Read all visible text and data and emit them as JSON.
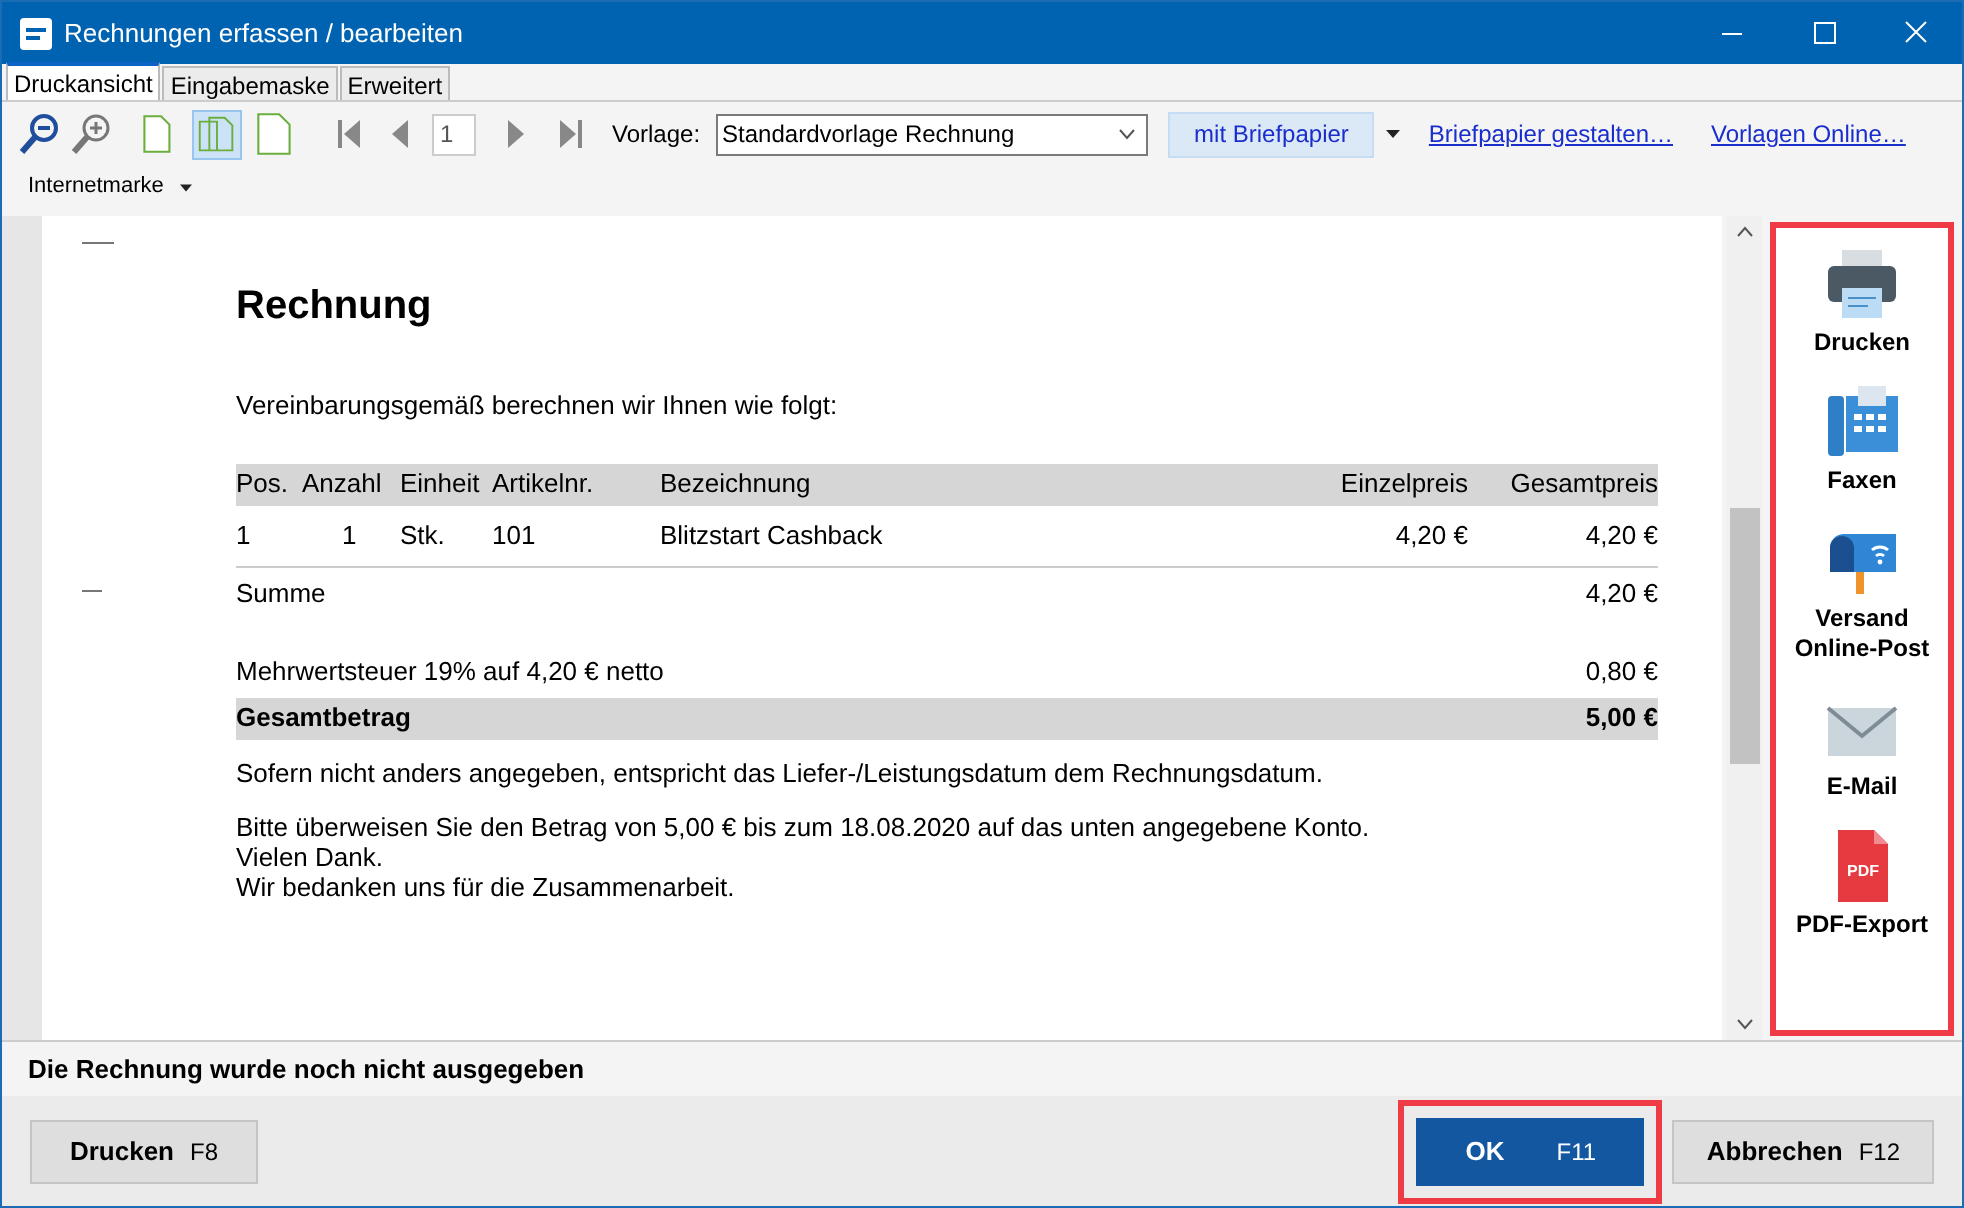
{
  "window": {
    "title": "Rechnungen erfassen / bearbeiten"
  },
  "tabs": [
    {
      "label": "Druckansicht",
      "selected": true
    },
    {
      "label": "Eingabemaske",
      "selected": false
    },
    {
      "label": "Erweitert",
      "selected": false
    }
  ],
  "toolbar": {
    "page_views": [
      {
        "kind": "single",
        "selected": false
      },
      {
        "kind": "double",
        "selected": true
      },
      {
        "kind": "wide",
        "selected": false
      }
    ],
    "page_number": "1",
    "template_label": "Vorlage:",
    "template_value": "Standardvorlage Rechnung",
    "letterhead_button": "mit Briefpapier",
    "links": [
      "Briefpapier gestalten…",
      "Vorlagen Online…"
    ],
    "stamp_menu": "Internetmarke"
  },
  "document": {
    "heading": "Rechnung",
    "intro": "Vereinbarungsgemäß berechnen wir Ihnen wie folgt:",
    "columns": [
      "Pos.",
      "Anzahl",
      "Einheit",
      "Artikelnr.",
      "Bezeichnung",
      "Einzelpreis",
      "Gesamtpreis"
    ],
    "rows": [
      [
        "1",
        "1",
        "Stk.",
        "101",
        "Blitzstart Cashback",
        "4,20 €",
        "4,20 €"
      ]
    ],
    "sum": {
      "label": "Summe",
      "value": "4,20 €"
    },
    "tax": {
      "label": "Mehrwertsteuer 19% auf 4,20 € netto",
      "value": "0,80 €"
    },
    "total": {
      "label": "Gesamtbetrag",
      "value": "5,00 €"
    },
    "notes": [
      "Sofern nicht anders angegeben, entspricht das Liefer-/Leistungsdatum dem Rechnungsdatum."
    ],
    "closing": [
      "Bitte überweisen Sie den Betrag von 5,00 € bis zum 18.08.2020 auf das unten angegebene Konto.",
      "Vielen Dank.",
      "Wir bedanken uns für die Zusammenarbeit."
    ]
  },
  "actions": [
    {
      "kind": "print",
      "label": "Drucken"
    },
    {
      "kind": "fax",
      "label": "Faxen"
    },
    {
      "kind": "mail",
      "label": "Versand Online-Post"
    },
    {
      "kind": "email",
      "label": "E-Mail"
    },
    {
      "kind": "pdf",
      "label": "PDF-Export",
      "icon_text": "PDF"
    }
  ],
  "status": "Die Rechnung wurde noch nicht ausgegeben",
  "buttons": [
    {
      "label": "Drucken",
      "shortcut": "F8",
      "kind": "secondary"
    },
    {
      "label": "OK",
      "shortcut": "F11",
      "kind": "primary"
    },
    {
      "label": "Abbrechen",
      "shortcut": "F12",
      "kind": "secondary"
    }
  ]
}
